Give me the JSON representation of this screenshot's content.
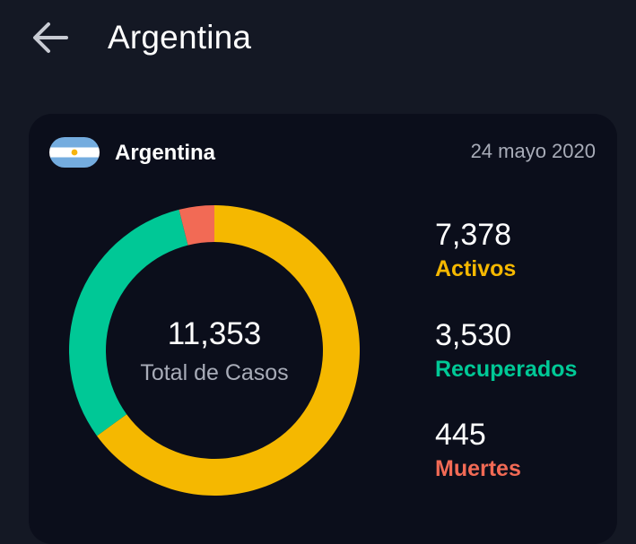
{
  "header": {
    "title": "Argentina",
    "back_icon": "arrow-left-icon"
  },
  "card": {
    "country": "Argentina",
    "flag_icon": "argentina-flag-icon",
    "date": "24 mayo 2020",
    "total": {
      "value": "11,353",
      "label": "Total de Casos"
    },
    "stats": [
      {
        "value": "7,378",
        "label": "Activos",
        "color": "#f5b800"
      },
      {
        "value": "3,530",
        "label": "Recuperados",
        "color": "#00c896"
      },
      {
        "value": "445",
        "label": "Muertes",
        "color": "#f26a55"
      }
    ]
  },
  "colors": {
    "background": "#141824",
    "card": "#0b0e1b",
    "activos": "#f5b800",
    "recuperados": "#00c896",
    "muertes": "#f26a55"
  }
}
